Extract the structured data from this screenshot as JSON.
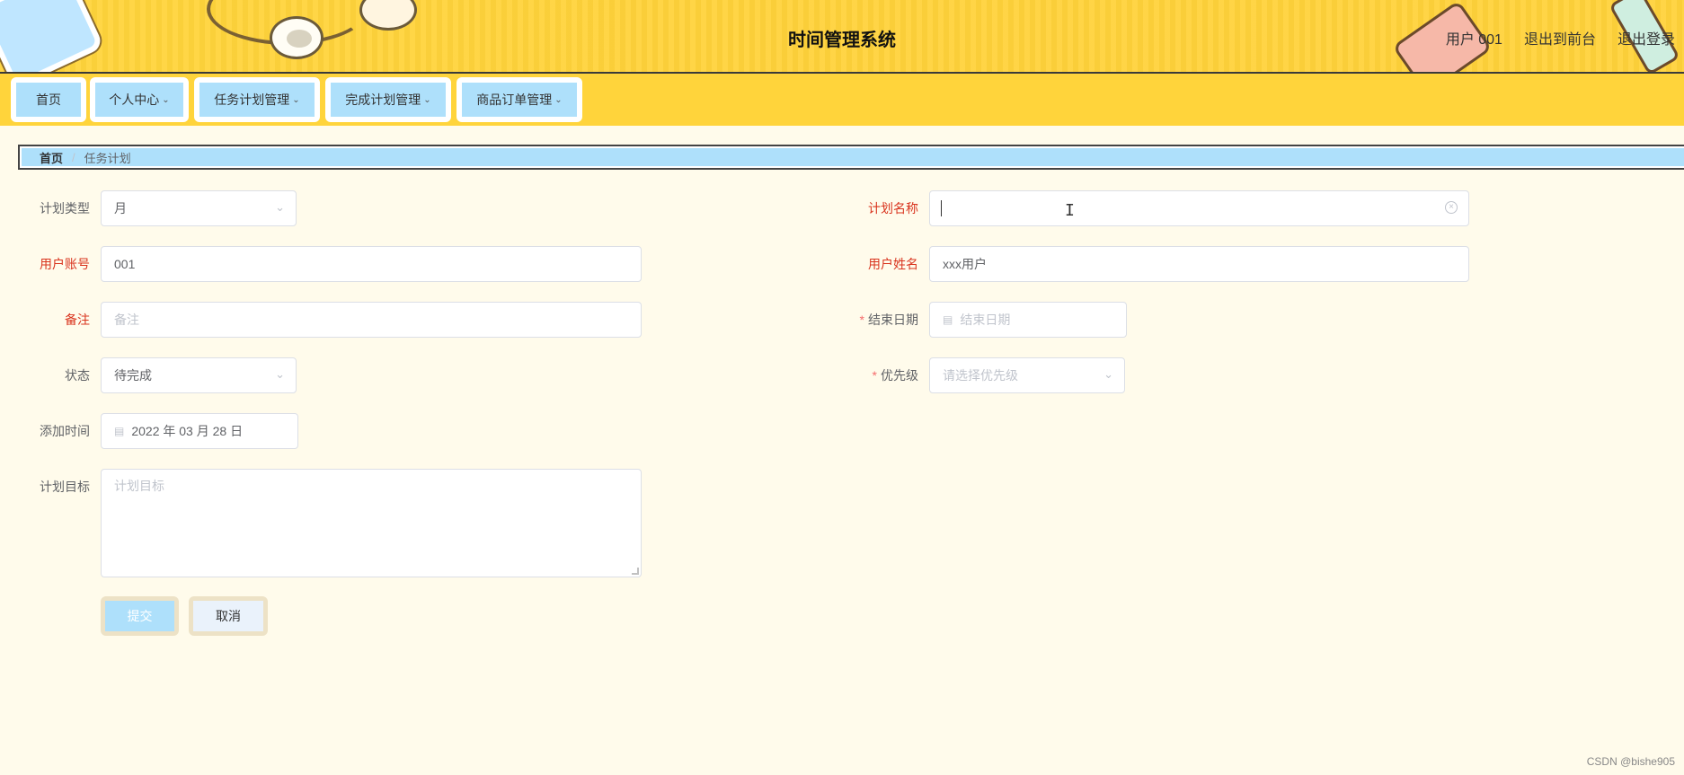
{
  "header": {
    "title": "时间管理系统",
    "user": "用户 001",
    "back_to_front": "退出到前台",
    "logout": "退出登录"
  },
  "nav": {
    "items": [
      {
        "label": "首页",
        "dropdown": false
      },
      {
        "label": "个人中心",
        "dropdown": true
      },
      {
        "label": "任务计划管理",
        "dropdown": true
      },
      {
        "label": "完成计划管理",
        "dropdown": true
      },
      {
        "label": "商品订单管理",
        "dropdown": true
      }
    ]
  },
  "breadcrumb": {
    "home": "首页",
    "separator": "/",
    "current": "任务计划"
  },
  "form": {
    "plan_type": {
      "label": "计划类型",
      "value": "月"
    },
    "plan_name": {
      "label": "计划名称",
      "value": ""
    },
    "user_account": {
      "label": "用户账号",
      "value": "001"
    },
    "user_name": {
      "label": "用户姓名",
      "value": "xxx用户"
    },
    "remark": {
      "label": "备注",
      "placeholder": "备注"
    },
    "end_date": {
      "label": "结束日期",
      "placeholder": "结束日期",
      "required_mark": "*"
    },
    "status": {
      "label": "状态",
      "value": "待完成"
    },
    "priority": {
      "label": "优先级",
      "placeholder": "请选择优先级",
      "required_mark": "*"
    },
    "add_time": {
      "label": "添加时间",
      "value": "2022 年 03 月 28 日"
    },
    "plan_goal": {
      "label": "计划目标",
      "placeholder": "计划目标"
    },
    "submit_label": "提交",
    "cancel_label": "取消"
  },
  "watermark": "CSDN @bishe905",
  "colors": {
    "header_yellow": "#ffd43b",
    "nav_button_blue": "#aee0fb",
    "page_bg": "#fffbeb",
    "label_red": "#d9341e"
  }
}
